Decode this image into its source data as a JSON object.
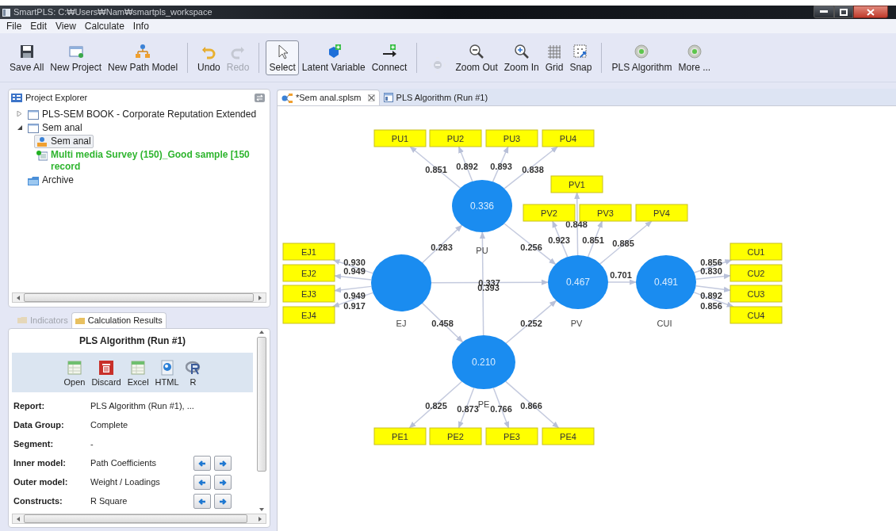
{
  "window": {
    "title": "SmartPLS: C:₩Users₩Nam₩smartpls_workspace"
  },
  "menu": [
    "File",
    "Edit",
    "View",
    "Calculate",
    "Info"
  ],
  "toolbar": {
    "groups": [
      [
        {
          "label": "Save All",
          "disabled": false,
          "selected": false
        },
        {
          "label": "New Project",
          "disabled": false,
          "selected": false
        },
        {
          "label": "New Path Model",
          "disabled": false,
          "selected": false
        }
      ],
      [
        {
          "label": "Undo",
          "disabled": false,
          "selected": false
        },
        {
          "label": "Redo",
          "disabled": true,
          "selected": false
        }
      ],
      [
        {
          "label": "Select",
          "disabled": false,
          "selected": true
        },
        {
          "label": "Latent Variable",
          "disabled": false,
          "selected": false
        },
        {
          "label": "Connect",
          "disabled": false,
          "selected": false
        }
      ],
      [
        {
          "disabled": true,
          "selected": false
        },
        {
          "label": "Zoom Out",
          "disabled": false,
          "selected": false
        },
        {
          "label": "Zoom In",
          "disabled": false,
          "selected": false
        },
        {
          "label": "Grid",
          "disabled": false,
          "selected": false
        },
        {
          "label": "Snap",
          "disabled": false,
          "selected": false
        }
      ],
      [
        {
          "label": "PLS Algorithm",
          "disabled": false,
          "selected": false
        },
        {
          "label": "More ...",
          "disabled": false,
          "selected": false
        }
      ]
    ]
  },
  "project_explorer": {
    "title": "Project Explorer",
    "tree": [
      {
        "label": "PLS-SEM BOOK - Corporate Reputation Extended",
        "kind": "project",
        "expanded": false,
        "selected": false
      },
      {
        "label": "Sem anal",
        "kind": "project",
        "expanded": true,
        "selected": false,
        "children": [
          {
            "label": "Sem anal",
            "kind": "model",
            "selected": true
          },
          {
            "label": "Multi media Survey (150)_Good sample [150 record",
            "kind": "data",
            "selected": false
          }
        ]
      },
      {
        "label": "Archive",
        "kind": "archive",
        "selected": false
      }
    ]
  },
  "calculation_results": {
    "tabs": [
      {
        "label": "Indicators",
        "selected": false
      },
      {
        "label": "Calculation Results",
        "selected": true
      }
    ],
    "title": "PLS Algorithm (Run #1)",
    "actions": [
      "Open",
      "Discard",
      "Excel",
      "HTML",
      "R"
    ],
    "rows": [
      {
        "label": "Report:",
        "value": "PLS Algorithm (Run #1), ...",
        "navigable": false
      },
      {
        "label": "Data Group:",
        "value": "Complete",
        "navigable": false
      },
      {
        "label": "Segment:",
        "value": "-",
        "navigable": false
      },
      {
        "label": "Inner model:",
        "value": "Path Coefficients",
        "navigable": true
      },
      {
        "label": "Outer model:",
        "value": "Weight / Loadings",
        "navigable": true
      },
      {
        "label": "Constructs:",
        "value": "R Square",
        "navigable": true
      }
    ]
  },
  "editor": {
    "tabs": [
      {
        "label": "*Sem anal.splsm",
        "selected": true,
        "closable": true
      },
      {
        "label": "PLS Algorithm (Run #1)",
        "selected": false,
        "closable": false
      }
    ],
    "model": {
      "constructs": [
        {
          "name": "PU",
          "value": "0.336",
          "indicators": [
            {
              "name": "PU1",
              "loading": "0.851"
            },
            {
              "name": "PU2",
              "loading": "0.892"
            },
            {
              "name": "PU3",
              "loading": "0.893"
            },
            {
              "name": "PU4",
              "loading": "0.838"
            }
          ]
        },
        {
          "name": "EJ",
          "indicators": [
            {
              "name": "EJ1",
              "loading": "0.930"
            },
            {
              "name": "EJ2",
              "loading": "0.949"
            },
            {
              "name": "EJ3",
              "loading": "0.949"
            },
            {
              "name": "EJ4",
              "loading": "0.917"
            }
          ]
        },
        {
          "name": "PV",
          "value": "0.467",
          "indicators": [
            {
              "name": "PV1",
              "loading": "0.848"
            },
            {
              "name": "PV2",
              "loading": "0.923"
            },
            {
              "name": "PV3",
              "loading": "0.851"
            },
            {
              "name": "PV4",
              "loading": "0.885"
            }
          ]
        },
        {
          "name": "CUI",
          "value": "0.491",
          "indicators": [
            {
              "name": "CU1",
              "loading": "0.856"
            },
            {
              "name": "CU2",
              "loading": "0.830"
            },
            {
              "name": "CU3",
              "loading": "0.892"
            },
            {
              "name": "CU4",
              "loading": "0.856"
            }
          ]
        },
        {
          "name": "PE",
          "value": "0.210",
          "indicators": [
            {
              "name": "PE1",
              "loading": "0.825"
            },
            {
              "name": "PE2",
              "loading": "0.873"
            },
            {
              "name": "PE3",
              "loading": "0.766"
            },
            {
              "name": "PE4",
              "loading": "0.866"
            }
          ]
        }
      ],
      "paths": [
        {
          "coefficient": "0.283"
        },
        {
          "coefficient": "0.256"
        },
        {
          "coefficient": "0.337"
        },
        {
          "coefficient": "0.393"
        },
        {
          "coefficient": "0.458"
        },
        {
          "coefficient": "0.252"
        },
        {
          "coefficient": "0.701"
        }
      ]
    }
  }
}
